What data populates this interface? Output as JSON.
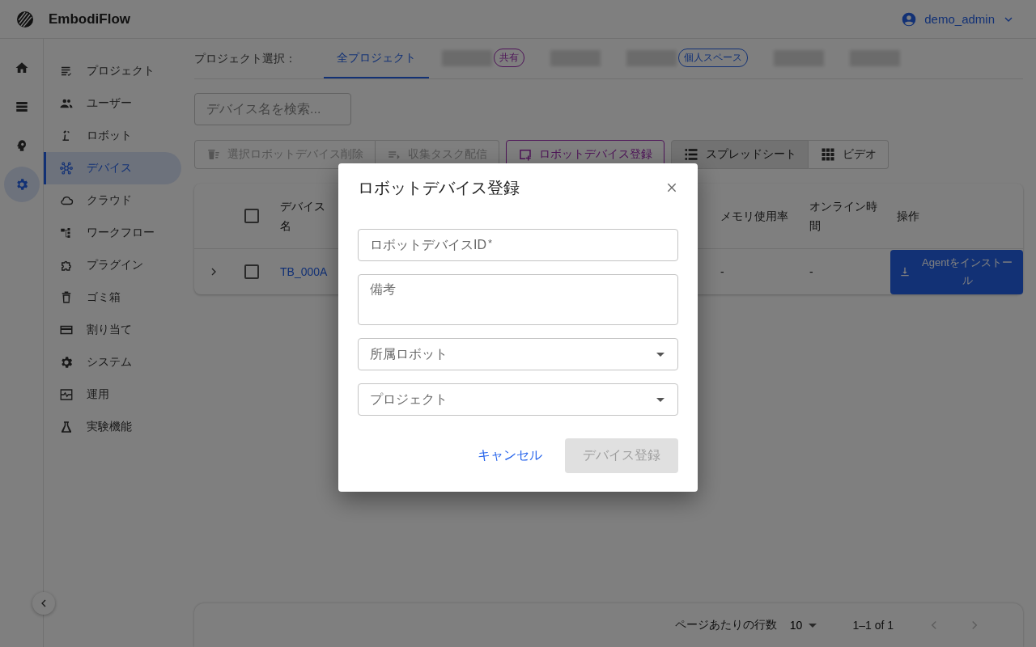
{
  "app": {
    "name": "EmbodiFlow"
  },
  "user": {
    "name": "demo_admin"
  },
  "rail": [
    {
      "kind": "home",
      "selected": false
    },
    {
      "kind": "list",
      "selected": false
    },
    {
      "kind": "head",
      "selected": false
    },
    {
      "kind": "gear",
      "selected": true
    }
  ],
  "sidebar": {
    "items": [
      {
        "label": "プロジェクト",
        "kind": "checklist",
        "selected": false
      },
      {
        "label": "ユーザー",
        "kind": "people",
        "selected": false
      },
      {
        "label": "ロボット",
        "kind": "robot",
        "selected": false
      },
      {
        "label": "デバイス",
        "kind": "hub",
        "selected": true
      },
      {
        "label": "クラウド",
        "kind": "cloud",
        "selected": false
      },
      {
        "label": "ワークフロー",
        "kind": "workflow",
        "selected": false
      },
      {
        "label": "プラグイン",
        "kind": "puzzle",
        "selected": false
      },
      {
        "label": "ゴミ箱",
        "kind": "trash",
        "selected": false
      },
      {
        "label": "割り当て",
        "kind": "card",
        "selected": false
      },
      {
        "label": "システム",
        "kind": "gear",
        "selected": false
      },
      {
        "label": "運用",
        "kind": "monitor",
        "selected": false
      },
      {
        "label": "実験機能",
        "kind": "flask",
        "selected": false
      }
    ]
  },
  "project_select": {
    "label": "プロジェクト選択：",
    "tabs": [
      {
        "label": "全プロジェクト",
        "selected": true
      },
      {
        "badge": "共有",
        "kind": "shared",
        "selected": false
      },
      {
        "selected": false
      },
      {
        "badge": "個人スペース",
        "kind": "personal",
        "selected": false
      },
      {
        "selected": false
      },
      {
        "selected": false
      }
    ]
  },
  "search": {
    "placeholder": "デバイス名を検索..."
  },
  "toolbar": {
    "buttons": [
      {
        "label": "選択ロボットデバイス削除",
        "kind": "delete",
        "disabled": true
      },
      {
        "label": "収集タスク配信",
        "kind": "send",
        "disabled": true
      },
      {
        "label": "ロボットデバイス登録",
        "kind": "register",
        "disabled": false
      }
    ],
    "view_toggle": [
      {
        "label": "スプレッドシート",
        "kind": "list",
        "selected": true
      },
      {
        "label": "ビデオ",
        "kind": "grid",
        "selected": false
      }
    ]
  },
  "table": {
    "all_checked": false,
    "columns": [
      "デバイス名",
      "メモリ使用率",
      "オンライン時間",
      "操作"
    ],
    "rows": [
      {
        "expanded": false,
        "checked": false,
        "cells": [
          "TB_000A",
          "-",
          "-"
        ],
        "action": "Agentをインストール"
      }
    ]
  },
  "pagination": {
    "rows_label": "ページあたりの行数",
    "rows_per_page": "10",
    "range": "1–1 of 1"
  },
  "dialog": {
    "title": "ロボットデバイス登録",
    "fields": [
      {
        "kind": "text",
        "placeholder": "ロボットデバイスID",
        "required_mark": "*"
      },
      {
        "kind": "multiline",
        "placeholder": "備考"
      },
      {
        "kind": "select",
        "placeholder": "所属ロボット"
      },
      {
        "kind": "select",
        "placeholder": "プロジェクト"
      }
    ],
    "cancel": "キャンセル",
    "submit": {
      "label": "デバイス登録",
      "disabled": true
    }
  }
}
